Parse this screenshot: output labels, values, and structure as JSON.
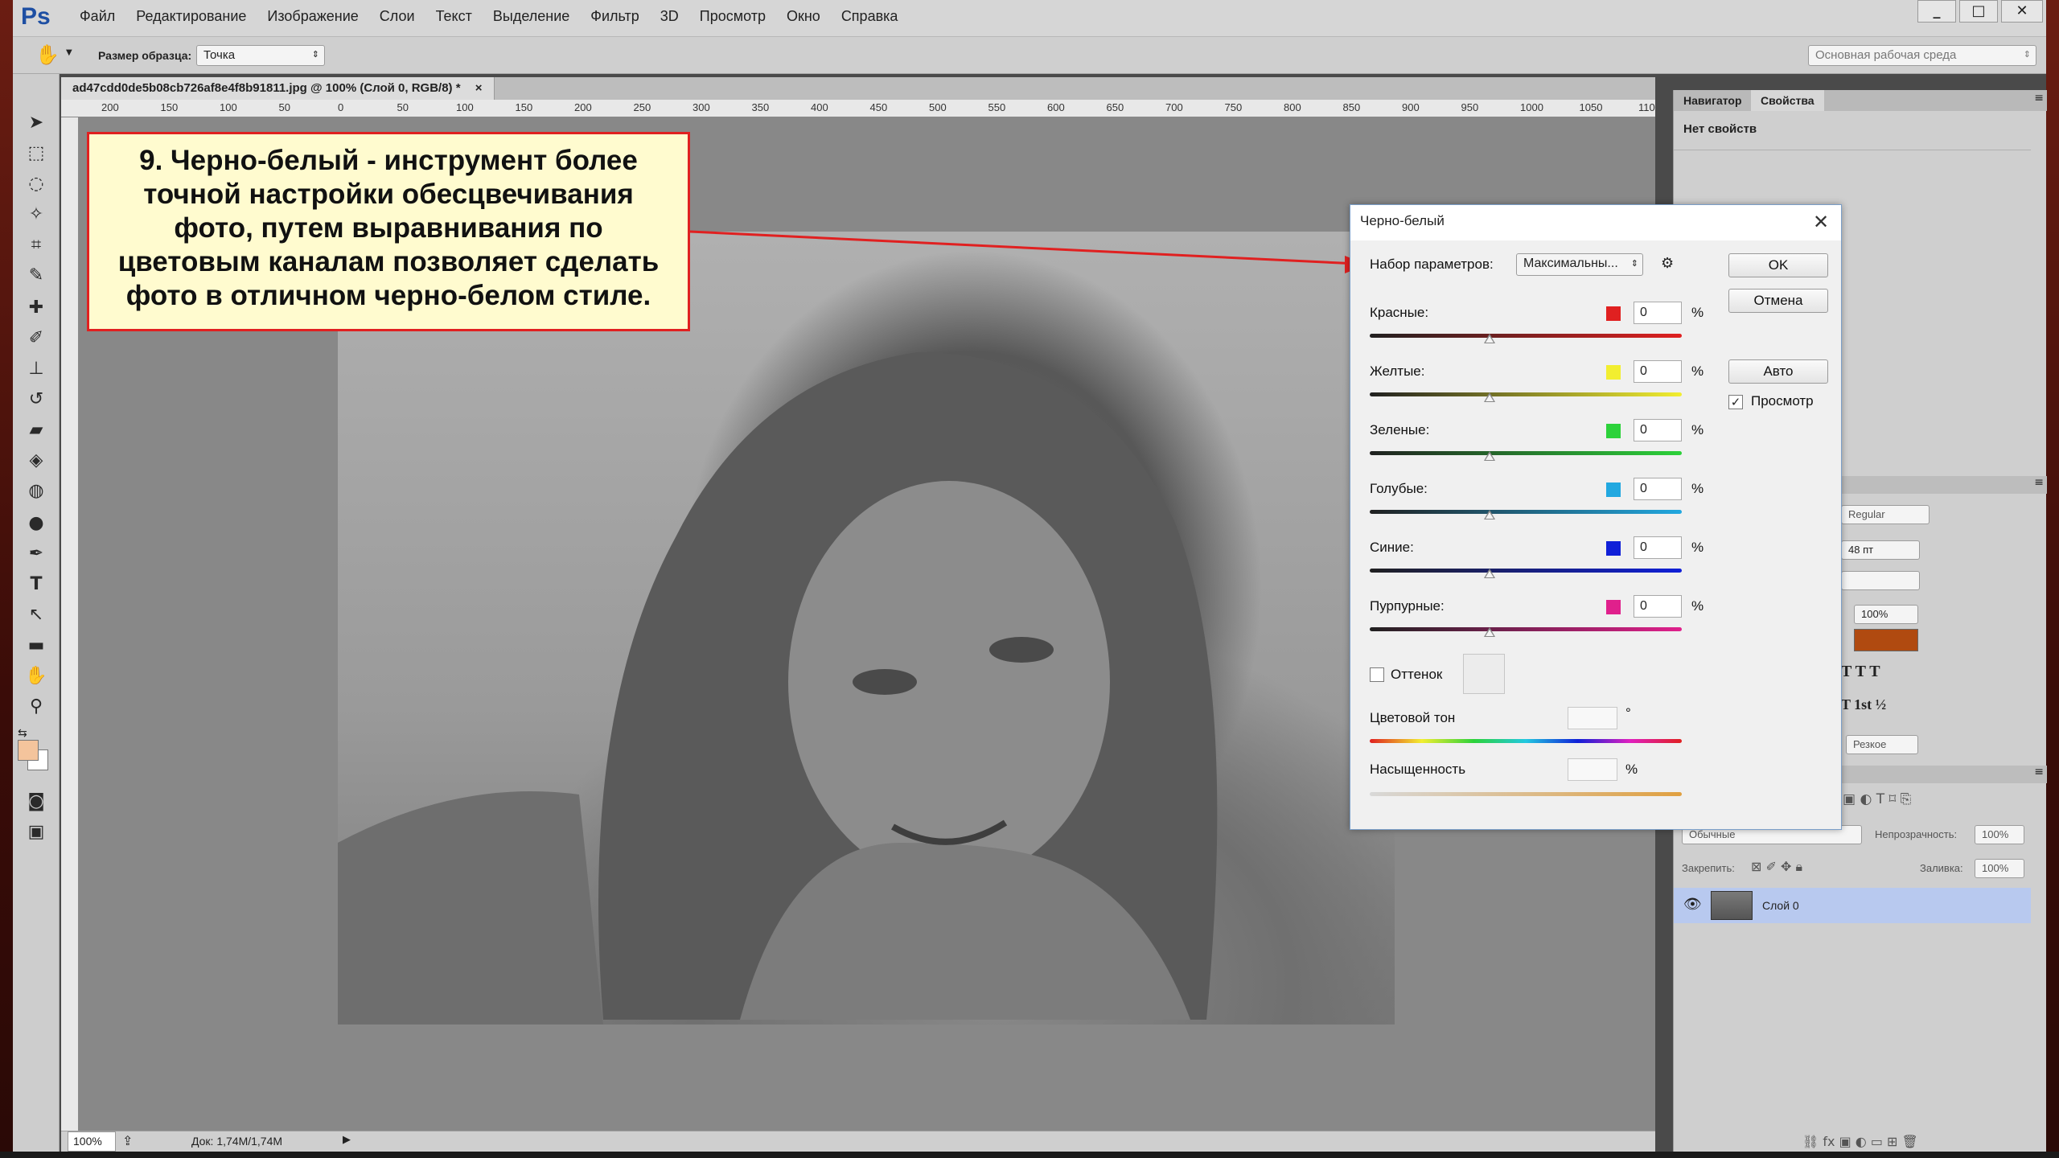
{
  "menubar": {
    "logo": "Ps",
    "items": [
      "Файл",
      "Редактирование",
      "Изображение",
      "Слои",
      "Текст",
      "Выделение",
      "Фильтр",
      "3D",
      "Просмотр",
      "Окно",
      "Справка"
    ],
    "window_buttons": [
      "_",
      "□",
      "✕"
    ]
  },
  "options": {
    "sample_size_label": "Размер образца:",
    "sample_size_value": "Точка",
    "workspace_value": "Основная рабочая среда"
  },
  "document": {
    "tab_title": "ad47cdd0de5b08cb726af8e4f8b91811.jpg @ 100% (Слой 0, RGB/8) *",
    "tab_close": "×",
    "ruler_ticks": [
      "200",
      "150",
      "100",
      "50",
      "0",
      "50",
      "100",
      "150",
      "200",
      "250",
      "300",
      "350",
      "400",
      "450",
      "500",
      "550",
      "600",
      "650",
      "700",
      "750",
      "800",
      "850",
      "900",
      "950",
      "1000",
      "1050",
      "110"
    ],
    "zoom": "100%",
    "doc_size": "Док: 1,74M/1,74M"
  },
  "annotation": {
    "text": "9. Черно-белый - инструмент более точной настройки обесцвечивания фото, путем выравнивания по цветовым каналам позволяет сделать фото в отличном черно-белом стиле."
  },
  "dialog": {
    "title": "Черно-белый",
    "preset_label": "Набор параметров:",
    "preset_value": "Максимальны...",
    "channels": [
      {
        "label": "Красные:",
        "value": "0",
        "color": "#e02020"
      },
      {
        "label": "Желтые:",
        "value": "0",
        "color": "#f2ee30"
      },
      {
        "label": "Зеленые:",
        "value": "0",
        "color": "#2cd23a"
      },
      {
        "label": "Голубые:",
        "value": "0",
        "color": "#22a8e0"
      },
      {
        "label": "Синие:",
        "value": "0",
        "color": "#1020d8"
      },
      {
        "label": "Пурпурные:",
        "value": "0",
        "color": "#e0208c"
      }
    ],
    "percent": "%",
    "tint_label": "Оттенок",
    "hue_label": "Цветовой тон",
    "hue_unit": "°",
    "saturation_label": "Насыщенность",
    "saturation_unit": "%",
    "ok_button": "OK",
    "cancel_button": "Отмена",
    "auto_button": "Авто",
    "preview_label": "Просмотр",
    "preview_checked": "✓"
  },
  "panels": {
    "tabs": [
      "Навигатор",
      "Свойства"
    ],
    "no_properties": "Нет свойств",
    "char_font_style": "Regular",
    "char_size": "48 пт",
    "char_scale": "100%",
    "char_color": "#b04a10",
    "antialias": "Резкое",
    "layers_mode": "Обычные",
    "opacity_label": "Непрозрачность:",
    "opacity_value": "100%",
    "lock_label": "Закрепить:",
    "fill_label": "Заливка:",
    "fill_value": "100%",
    "layer_name": "Слой 0"
  }
}
